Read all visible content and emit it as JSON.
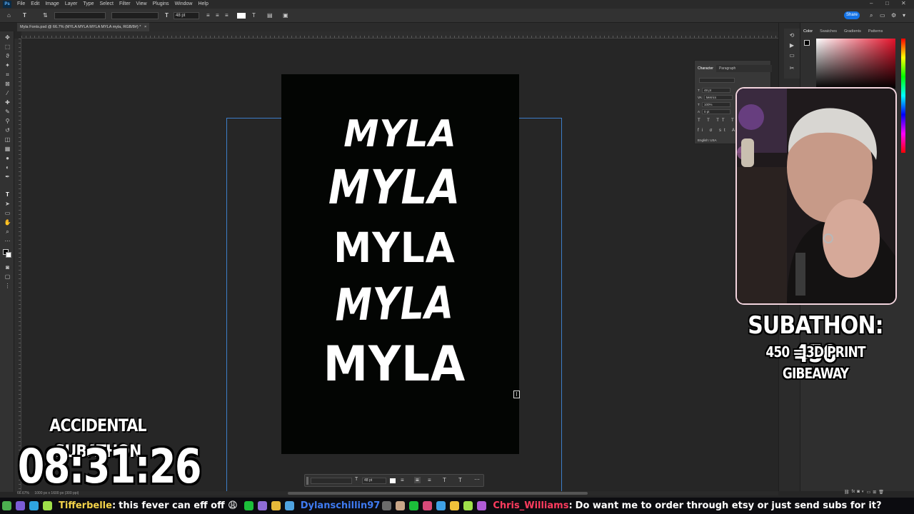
{
  "menubar": {
    "items": [
      "File",
      "Edit",
      "Image",
      "Layer",
      "Type",
      "Select",
      "Filter",
      "View",
      "Plugins",
      "Window",
      "Help"
    ]
  },
  "options_bar": {
    "font_size": "48 pt",
    "share_label": "Share"
  },
  "document_tab": {
    "title": "Myla Fonts.psd @ 66.7% (MYLA MYLA MYLA MYLA myla, RGB/8#) *",
    "close": "×"
  },
  "canvas": {
    "lines": [
      "MYLA",
      "MYLA",
      "MYLA",
      "MYLA",
      "MYLA"
    ]
  },
  "context_bar": {
    "font_size": "48 pt"
  },
  "status_bar": {
    "zoom": "66.67%",
    "doc_info": "1000 px x 1600 px (300 ppi)"
  },
  "color_panel": {
    "tabs": [
      "Color",
      "Swatches",
      "Gradients",
      "Patterns"
    ]
  },
  "character_panel": {
    "tabs": [
      "Character",
      "Paragraph"
    ],
    "font_size": "48 pt",
    "kerning": "Metrics",
    "scale": "100%",
    "tracking": "0 pt",
    "language": "English: USA"
  },
  "stream_overlay": {
    "subathon_title": "SUBATHON: 450",
    "subathon_sub": "450 = 3D PRINT GIBEAWAY",
    "accidental_title": "ACCIDENTAL SUBATHON",
    "timer": "08:31:26"
  },
  "chat": [
    {
      "user": "Tifferbelle",
      "user_color": "#f3d34a",
      "message": "this fever can eff off 😩"
    },
    {
      "user": "Dylanschillin97",
      "user_color": "#3f7bf2",
      "message": ""
    },
    {
      "user": "Chris_Williams",
      "user_color": "#ff3c5f",
      "message": "Do want me to order through etsy or just send subs for it?"
    }
  ]
}
